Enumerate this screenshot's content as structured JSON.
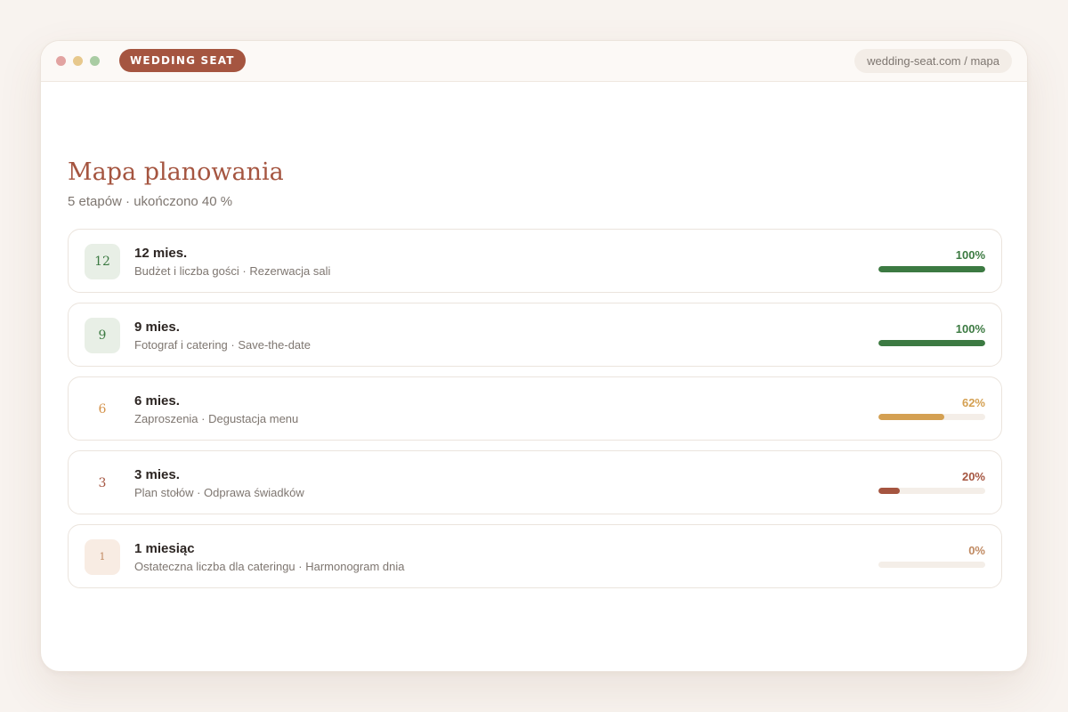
{
  "app": {
    "brand": "WEDDING SEAT",
    "url": "wedding-seat.com / mapa"
  },
  "page": {
    "title": "Mapa planowania",
    "subtitle": "5 etapów · ukończono 40 %"
  },
  "colors": {
    "done": "#3c7a42",
    "progress": "#d4a052",
    "low": "#a55540",
    "todo": "#c08a62"
  },
  "milestones": [
    {
      "badge": "12",
      "title": "12 mies.",
      "tasks": "Budżet i liczba gości · Rezerwacja sali",
      "percent_label": "100%",
      "progress": 1.0,
      "state": "done"
    },
    {
      "badge": "9",
      "title": "9 mies.",
      "tasks": "Fotograf i catering · Save-the-date",
      "percent_label": "100%",
      "progress": 1.0,
      "state": "done"
    },
    {
      "badge": "6",
      "title": "6 mies.",
      "tasks": "Zaproszenia · Degustacja menu",
      "percent_label": "62%",
      "progress": 0.62,
      "state": "progress"
    },
    {
      "badge": "3",
      "title": "3 mies.",
      "tasks": "Plan stołów · Odprawa świadków",
      "percent_label": "20%",
      "progress": 0.2,
      "state": "low"
    },
    {
      "badge": "1",
      "title": "1 miesiąc",
      "tasks": "Ostateczna liczba dla cateringu · Harmonogram dnia",
      "percent_label": "0%",
      "progress": 0.0,
      "state": "todo"
    }
  ]
}
